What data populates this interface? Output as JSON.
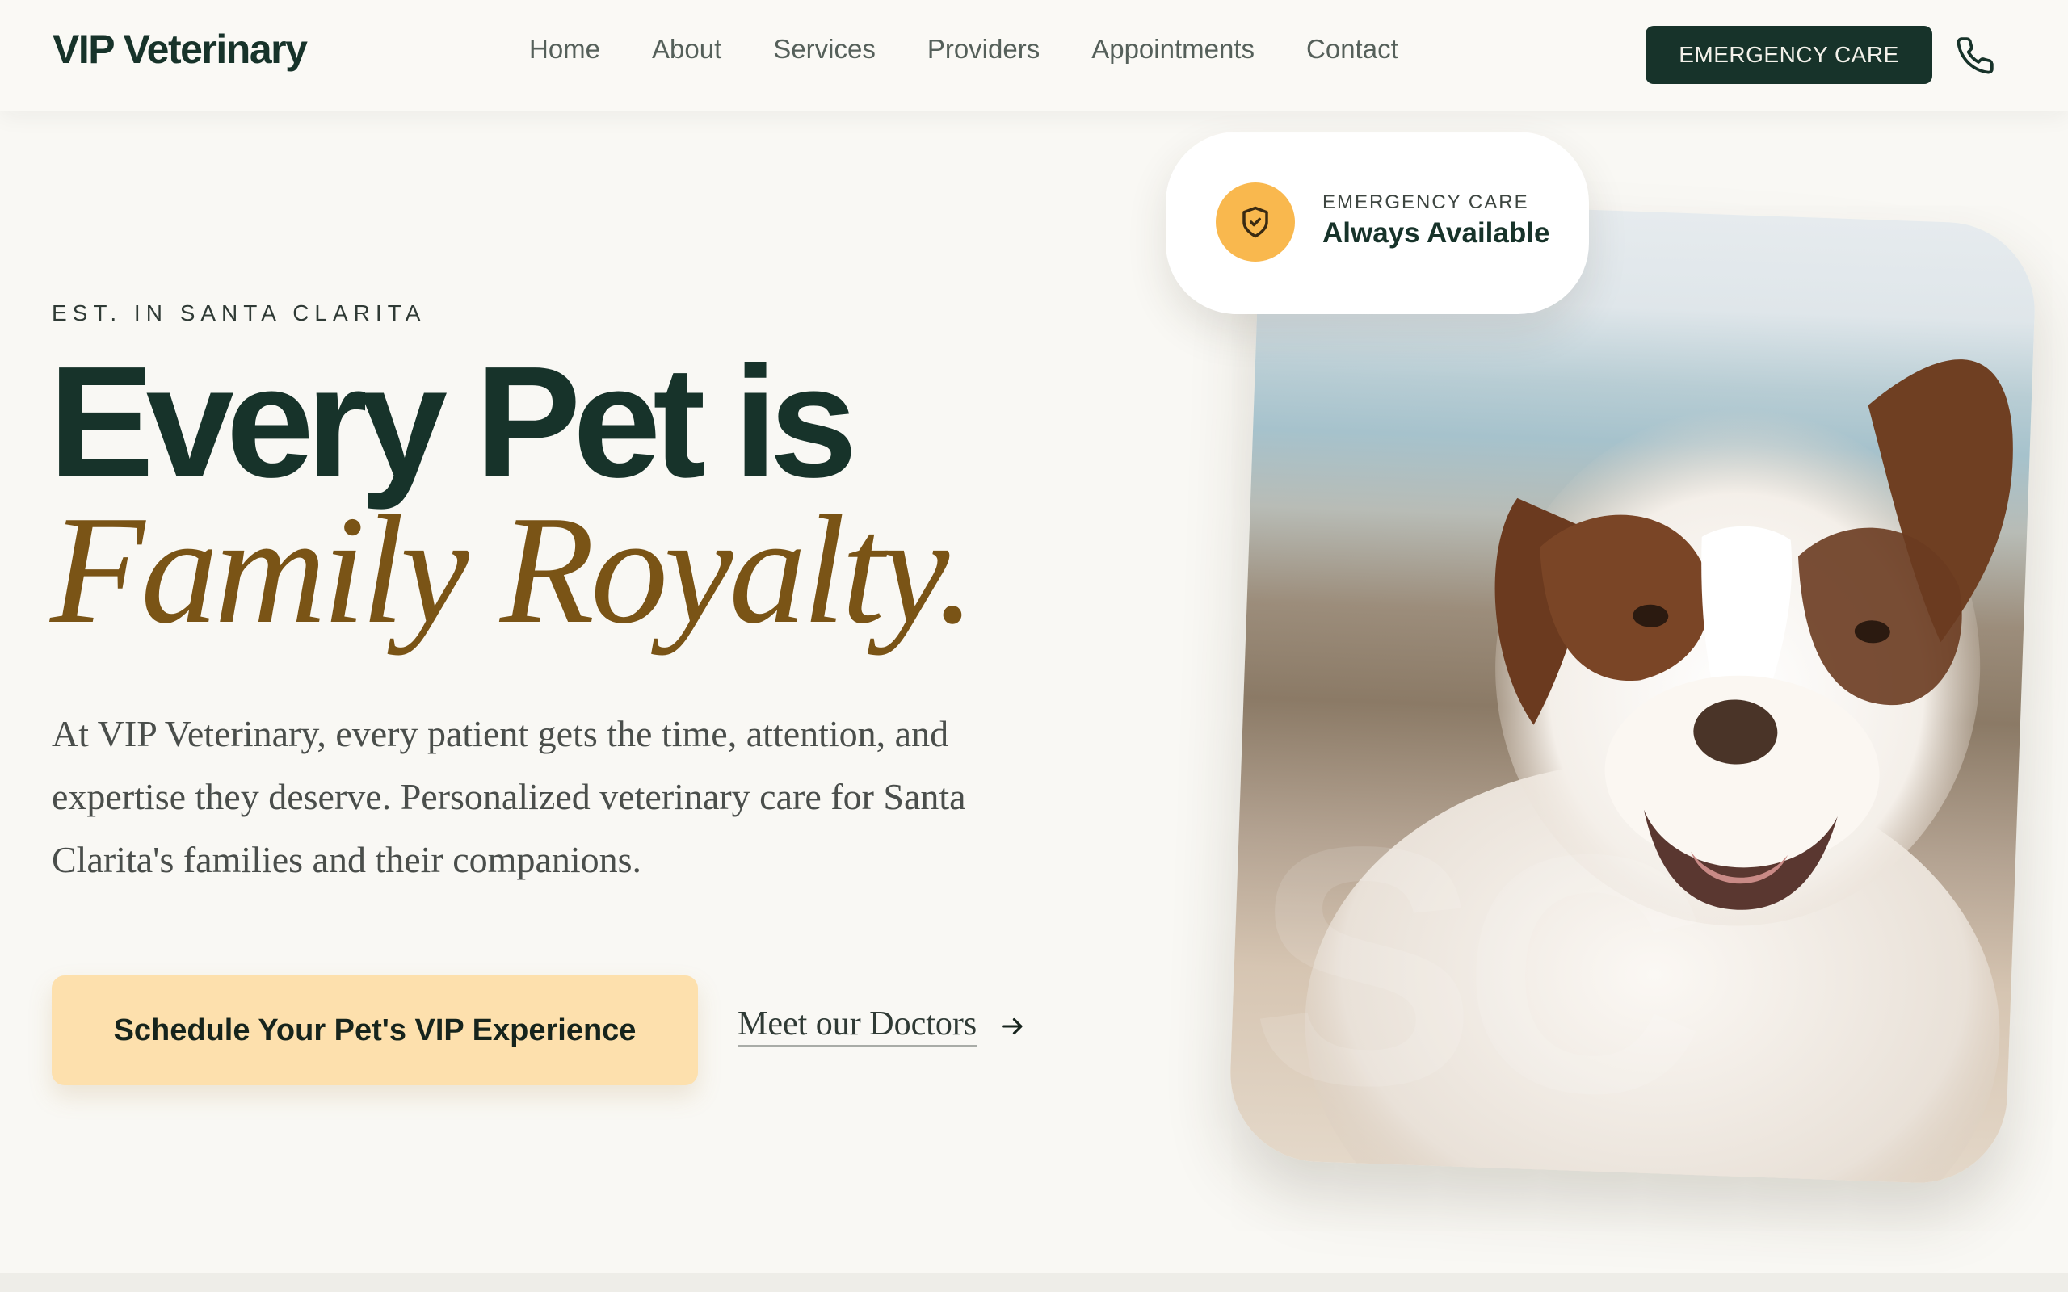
{
  "header": {
    "logo": "VIP Veterinary",
    "nav": [
      "Home",
      "About",
      "Services",
      "Providers",
      "Appointments",
      "Contact"
    ],
    "emergency_button": "EMERGENCY CARE",
    "phone_icon": "phone-icon"
  },
  "hero": {
    "eyebrow": "EST. IN SANTA CLARITA",
    "headline_line1": "Every Pet is",
    "headline_line2": "Family Royalty.",
    "intro": "At VIP Veterinary, every patient gets the time, attention, and expertise they deserve. Personalized veterinary care for Santa Clarita's families and their companions.",
    "primary_cta": "Schedule Your Pet's VIP Experience",
    "secondary_cta": "Meet our Doctors",
    "secondary_cta_icon": "arrow-right-icon"
  },
  "badge": {
    "icon": "shield-check-icon",
    "kicker": "EMERGENCY CARE",
    "title": "Always Available"
  },
  "photo": {
    "subject": "dog-photo",
    "watermark": "SC"
  },
  "colors": {
    "brand_dark": "#17332a",
    "accent_gold": "#7a5416",
    "cta_bg": "#fde0ad",
    "badge_icon_bg": "#f9b84e",
    "page_bg": "#f9f8f4"
  }
}
